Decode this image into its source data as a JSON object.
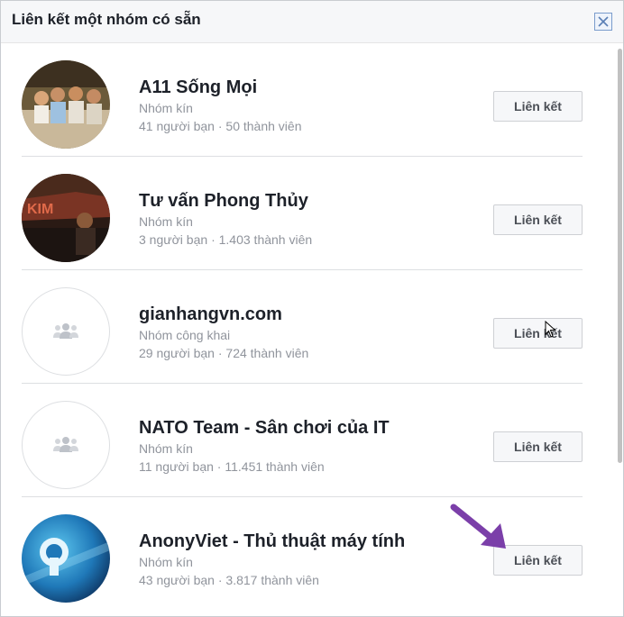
{
  "dialog": {
    "title": "Liên kết một nhóm có sẵn",
    "close_icon": "close-icon"
  },
  "groups": [
    {
      "name": "A11 Sống Mọi",
      "type": "Nhóm kín",
      "friends": "41 người bạn",
      "separator": "·",
      "members": "50 thành viên",
      "button_label": "Liên kết",
      "avatar": "photo"
    },
    {
      "name": "Tư vấn Phong Thủy",
      "type": "Nhóm kín",
      "friends": "3 người bạn",
      "separator": "·",
      "members": "1.403 thành viên",
      "button_label": "Liên kết",
      "avatar": "photo"
    },
    {
      "name": "gianhangvn.com",
      "type": "Nhóm công khai",
      "friends": "29 người bạn",
      "separator": "·",
      "members": "724 thành viên",
      "button_label": "Liên kết",
      "avatar": "group-placeholder-icon"
    },
    {
      "name": "NATO Team - Sân chơi của IT",
      "type": "Nhóm kín",
      "friends": "11 người bạn",
      "separator": "·",
      "members": "11.451 thành viên",
      "button_label": "Liên kết",
      "avatar": "group-placeholder-icon"
    },
    {
      "name": "AnonyViet - Thủ thuật máy tính",
      "type": "Nhóm kín",
      "friends": "43 người bạn",
      "separator": "·",
      "members": "3.817 thành viên",
      "button_label": "Liên kết",
      "avatar": "photo"
    }
  ],
  "annotation": {
    "icon": "purple-arrow-icon",
    "color": "#7b3fa9"
  },
  "colors": {
    "header_bg": "#f6f7f9",
    "muted_text": "#90949c",
    "button_bg": "#f6f7f9"
  }
}
